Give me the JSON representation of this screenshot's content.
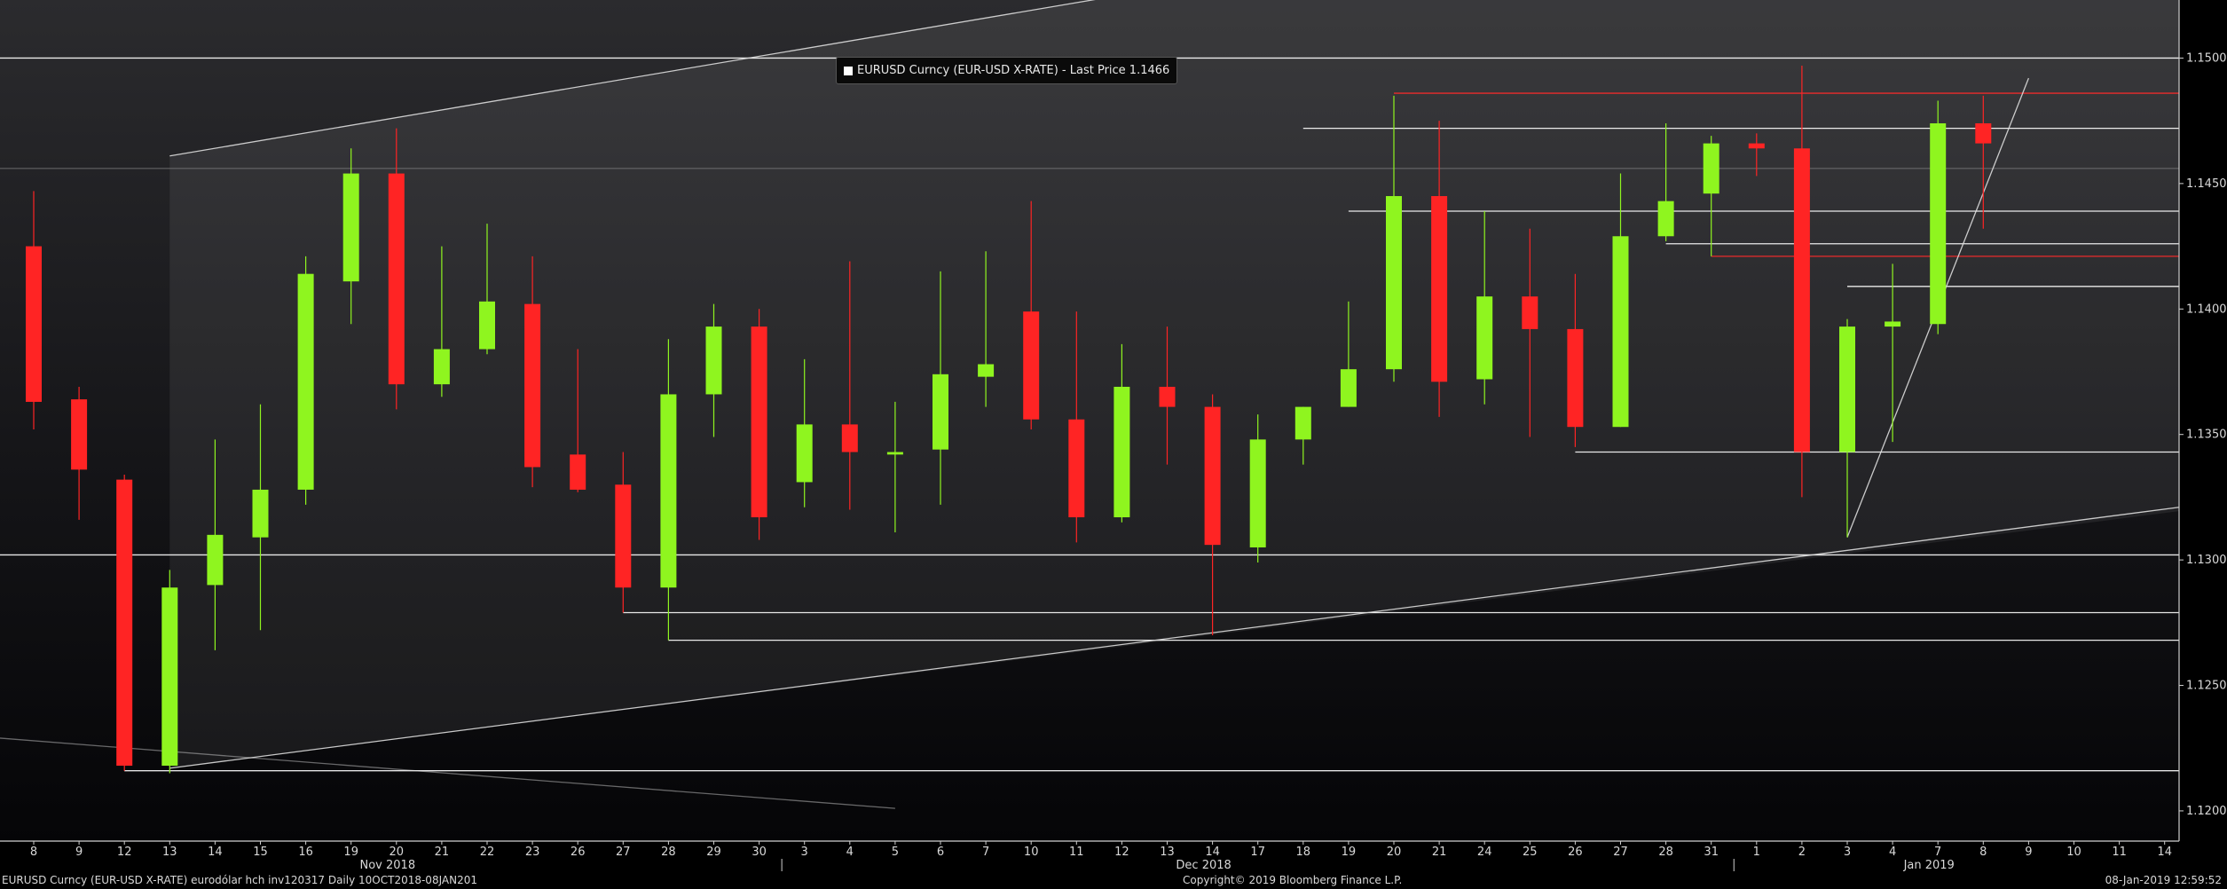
{
  "legend": {
    "text": "EURUSD Curncy (EUR-USD X-RATE) - Last Price 1.1466"
  },
  "footer": {
    "left": "EURUSD Curncy (EUR-USD X-RATE) eurodólar hch inv120317  Daily 10OCT2018-08JAN201",
    "center": "Copyright© 2019 Bloomberg Finance L.P.",
    "right": "08-Jan-2019 12:59:52"
  },
  "colors": {
    "up": "#8ff51f",
    "down": "#ff2424",
    "background": "#000000",
    "panel": "#2a2a2d",
    "line": "#ffffff",
    "red_line": "#ff2a2a",
    "text": "#d8d8d8"
  },
  "chart_data": {
    "type": "candlestick",
    "ylim": [
      1.119,
      1.151
    ],
    "yticks": [
      "1.1200",
      "1.1250",
      "1.1300",
      "1.1350",
      "1.1400",
      "1.1450",
      "1.1500"
    ],
    "categories": [
      "8",
      "9",
      "12",
      "13",
      "14",
      "15",
      "16",
      "19",
      "20",
      "21",
      "22",
      "23",
      "26",
      "27",
      "28",
      "29",
      "30",
      "3",
      "4",
      "5",
      "6",
      "7",
      "10",
      "11",
      "12",
      "13",
      "14",
      "17",
      "18",
      "19",
      "20",
      "21",
      "24",
      "25",
      "26",
      "27",
      "28",
      "31",
      "1",
      "2",
      "3",
      "4",
      "7",
      "8",
      "9",
      "10",
      "11",
      "14"
    ],
    "month_labels": [
      {
        "text": "Nov 2018",
        "at": "20"
      },
      {
        "text": "Dec 2018",
        "at": "14"
      },
      {
        "text": "Jan 2019",
        "at": "7"
      }
    ],
    "candles": [
      {
        "date": "8",
        "open": 1.1425,
        "high": 1.1447,
        "low": 1.1352,
        "close": 1.1363
      },
      {
        "date": "9",
        "open": 1.1364,
        "high": 1.1369,
        "low": 1.1316,
        "close": 1.1336
      },
      {
        "date": "12",
        "open": 1.1332,
        "high": 1.1334,
        "low": 1.1216,
        "close": 1.1218
      },
      {
        "date": "13",
        "open": 1.1218,
        "high": 1.1296,
        "low": 1.1215,
        "close": 1.1289
      },
      {
        "date": "14",
        "open": 1.129,
        "high": 1.1348,
        "low": 1.1264,
        "close": 1.131
      },
      {
        "date": "15",
        "open": 1.1309,
        "high": 1.1362,
        "low": 1.1272,
        "close": 1.1328
      },
      {
        "date": "16",
        "open": 1.1328,
        "high": 1.1421,
        "low": 1.1322,
        "close": 1.1414
      },
      {
        "date": "19",
        "open": 1.1411,
        "high": 1.1464,
        "low": 1.1394,
        "close": 1.1454
      },
      {
        "date": "20",
        "open": 1.1454,
        "high": 1.1472,
        "low": 1.136,
        "close": 1.137
      },
      {
        "date": "21",
        "open": 1.137,
        "high": 1.1425,
        "low": 1.1365,
        "close": 1.1384
      },
      {
        "date": "22",
        "open": 1.1384,
        "high": 1.1434,
        "low": 1.1382,
        "close": 1.1403
      },
      {
        "date": "23",
        "open": 1.1402,
        "high": 1.1421,
        "low": 1.1329,
        "close": 1.1337
      },
      {
        "date": "26",
        "open": 1.1342,
        "high": 1.1384,
        "low": 1.1327,
        "close": 1.1328
      },
      {
        "date": "27",
        "open": 1.133,
        "high": 1.1343,
        "low": 1.1279,
        "close": 1.1289
      },
      {
        "date": "28",
        "open": 1.1289,
        "high": 1.1388,
        "low": 1.1268,
        "close": 1.1366
      },
      {
        "date": "29",
        "open": 1.1366,
        "high": 1.1402,
        "low": 1.1349,
        "close": 1.1393
      },
      {
        "date": "30",
        "open": 1.1393,
        "high": 1.14,
        "low": 1.1308,
        "close": 1.1317
      },
      {
        "date": "3",
        "open": 1.1331,
        "high": 1.138,
        "low": 1.1321,
        "close": 1.1354
      },
      {
        "date": "4",
        "open": 1.1354,
        "high": 1.1419,
        "low": 1.132,
        "close": 1.1343
      },
      {
        "date": "5",
        "open": 1.1342,
        "high": 1.1363,
        "low": 1.1311,
        "close": 1.1343
      },
      {
        "date": "6",
        "open": 1.1344,
        "high": 1.1415,
        "low": 1.1322,
        "close": 1.1374
      },
      {
        "date": "7",
        "open": 1.1373,
        "high": 1.1423,
        "low": 1.1361,
        "close": 1.1378
      },
      {
        "date": "10",
        "open": 1.1399,
        "high": 1.1443,
        "low": 1.1352,
        "close": 1.1356
      },
      {
        "date": "11",
        "open": 1.1356,
        "high": 1.1399,
        "low": 1.1307,
        "close": 1.1317
      },
      {
        "date": "12",
        "open": 1.1317,
        "high": 1.1386,
        "low": 1.1315,
        "close": 1.1369
      },
      {
        "date": "13",
        "open": 1.1369,
        "high": 1.1393,
        "low": 1.1338,
        "close": 1.1361
      },
      {
        "date": "14",
        "open": 1.1361,
        "high": 1.1366,
        "low": 1.127,
        "close": 1.1306
      },
      {
        "date": "17",
        "open": 1.1305,
        "high": 1.1358,
        "low": 1.1299,
        "close": 1.1348
      },
      {
        "date": "18",
        "open": 1.1348,
        "high": 1.1361,
        "low": 1.1338,
        "close": 1.1361
      },
      {
        "date": "19",
        "open": 1.1361,
        "high": 1.1403,
        "low": 1.1361,
        "close": 1.1376
      },
      {
        "date": "20",
        "open": 1.1376,
        "high": 1.1485,
        "low": 1.1371,
        "close": 1.1445
      },
      {
        "date": "21",
        "open": 1.1445,
        "high": 1.1475,
        "low": 1.1357,
        "close": 1.1371
      },
      {
        "date": "24",
        "open": 1.1372,
        "high": 1.1439,
        "low": 1.1362,
        "close": 1.1405
      },
      {
        "date": "25",
        "open": 1.1405,
        "high": 1.1432,
        "low": 1.1349,
        "close": 1.1392
      },
      {
        "date": "26",
        "open": 1.1392,
        "high": 1.1414,
        "low": 1.1345,
        "close": 1.1353
      },
      {
        "date": "27",
        "open": 1.1353,
        "high": 1.1454,
        "low": 1.1353,
        "close": 1.1429
      },
      {
        "date": "28",
        "open": 1.1429,
        "high": 1.1474,
        "low": 1.1427,
        "close": 1.1443
      },
      {
        "date": "31",
        "open": 1.1446,
        "high": 1.1469,
        "low": 1.1421,
        "close": 1.1466
      },
      {
        "date": "1",
        "open": 1.1466,
        "high": 1.147,
        "low": 1.1453,
        "close": 1.1464
      },
      {
        "date": "2",
        "open": 1.1464,
        "high": 1.1497,
        "low": 1.1325,
        "close": 1.1343
      },
      {
        "date": "3",
        "open": 1.1343,
        "high": 1.1396,
        "low": 1.1309,
        "close": 1.1393
      },
      {
        "date": "4",
        "open": 1.1393,
        "high": 1.1418,
        "low": 1.1347,
        "close": 1.1395
      },
      {
        "date": "7",
        "open": 1.1394,
        "high": 1.1483,
        "low": 1.139,
        "close": 1.1474
      },
      {
        "date": "8",
        "open": 1.1474,
        "high": 1.1485,
        "low": 1.1432,
        "close": 1.1466
      }
    ],
    "horizontal_lines": [
      {
        "y": 1.15,
        "from_index": -1,
        "to_index": 48,
        "color": "white"
      },
      {
        "y": 1.1472,
        "from_index": 28,
        "to_index": 48,
        "color": "white"
      },
      {
        "y": 1.1456,
        "from_index": -1,
        "to_index": 48,
        "color": "gray"
      },
      {
        "y": 1.1439,
        "from_index": 29,
        "to_index": 48,
        "color": "white"
      },
      {
        "y": 1.1426,
        "from_index": 36,
        "to_index": 48,
        "color": "white"
      },
      {
        "y": 1.1409,
        "from_index": 40,
        "to_index": 48,
        "color": "white"
      },
      {
        "y": 1.1343,
        "from_index": 34,
        "to_index": 48,
        "color": "white"
      },
      {
        "y": 1.1302,
        "from_index": -1,
        "to_index": 48,
        "color": "white"
      },
      {
        "y": 1.1279,
        "from_index": 13,
        "to_index": 48,
        "color": "white"
      },
      {
        "y": 1.1268,
        "from_index": 14,
        "to_index": 48,
        "color": "white"
      },
      {
        "y": 1.1216,
        "from_index": 2,
        "to_index": 48,
        "color": "white"
      },
      {
        "y": 1.1486,
        "from_index": 30,
        "to_index": 48,
        "color": "red"
      },
      {
        "y": 1.1421,
        "from_index": 37,
        "to_index": 48,
        "color": "red"
      }
    ],
    "trend_lines": [
      {
        "from": [
          3,
          1.1461
        ],
        "to": [
          30.5,
          1.1545
        ]
      },
      {
        "from": [
          3,
          1.1217
        ],
        "to": [
          48,
          1.1321
        ]
      },
      {
        "from": [
          40,
          1.1309
        ],
        "to": [
          44,
          1.1492
        ]
      },
      {
        "from": [
          -1,
          1.1229
        ],
        "to": [
          19,
          1.1201
        ]
      }
    ],
    "channel": {
      "from_index": 3,
      "upper": [
        1.1461,
        1.1545
      ],
      "upper_to_index": 30.5,
      "lower": [
        1.1217,
        1.1321
      ],
      "lower_to_index": 48
    }
  }
}
